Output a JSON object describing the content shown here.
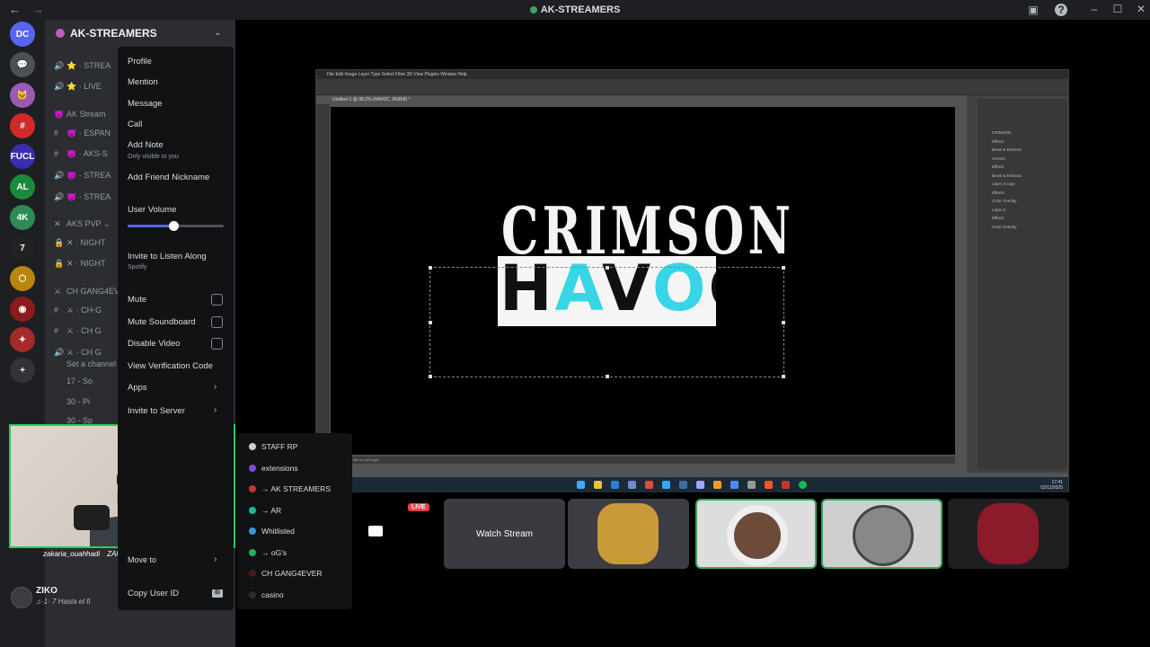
{
  "window": {
    "title": "AK-STREAMERS",
    "back": "←",
    "forward": "→"
  },
  "guilds": [
    {
      "label": "DC",
      "color": "#5865f2"
    },
    {
      "label": "💬",
      "color": "#4e5058"
    },
    {
      "label": "🐱",
      "color": "#9b59b6"
    },
    {
      "label": "#",
      "color": "#d12a2a"
    },
    {
      "label": "FUCL",
      "color": "#3b2db0"
    },
    {
      "label": "AL",
      "color": "#1a8a3a"
    },
    {
      "label": "4K",
      "color": "#2e8b57"
    },
    {
      "label": "7",
      "color": "#222"
    },
    {
      "label": "⬡",
      "color": "#b8860b"
    },
    {
      "label": "◉",
      "color": "#8b1a1a"
    },
    {
      "label": "✦",
      "color": "#a52a2a"
    },
    {
      "label": "+",
      "color": "#313338"
    }
  ],
  "sidebar": {
    "server_name": "AK-STREAMERS",
    "channels": [
      {
        "icon": "🔊",
        "text": "⭐ · STREA"
      },
      {
        "icon": "🔊",
        "text": "⭐ · LIVE"
      },
      {
        "icon": "😈",
        "text": "AK Stream"
      },
      {
        "icon": "#",
        "text": "😈 · ESPAN"
      },
      {
        "icon": "#",
        "text": "😈 · AKS-S"
      },
      {
        "icon": "🔊",
        "text": "😈 · STREA"
      },
      {
        "icon": "🔊",
        "text": "😈 · STREA"
      },
      {
        "icon": "✕",
        "text": "AKS PVP ⌄"
      },
      {
        "icon": "🔒",
        "text": "✕ · NIGHT"
      },
      {
        "icon": "🔒",
        "text": "✕ · NIGHT"
      },
      {
        "icon": "⚔",
        "text": "CH GANG4EV"
      },
      {
        "icon": "#",
        "text": "⚔ · CH-G"
      },
      {
        "icon": "#",
        "text": "⚔ · CH G"
      },
      {
        "icon": "🔊",
        "text": "⚔ · CH G"
      },
      {
        "icon": "",
        "text": "Set a channel"
      },
      {
        "icon": "",
        "text": "17 - So"
      },
      {
        "icon": "",
        "text": "30 - Pi"
      },
      {
        "icon": "",
        "text": "30 - Sp"
      }
    ]
  },
  "context_menu": {
    "profile": "Profile",
    "mention": "Mention",
    "message": "Message",
    "call": "Call",
    "add_note": "Add Note",
    "add_note_sub": "Only visible to you",
    "add_friend_nickname": "Add Friend Nickname",
    "user_volume": "User Volume",
    "user_volume_level": 0.48,
    "invite_listen": "Invite to Listen Along",
    "invite_listen_sub": "Spotify",
    "mute": "Mute",
    "mute_soundboard": "Mute Soundboard",
    "disable_video": "Disable Video",
    "view_verification": "View Verification Code",
    "apps": "Apps",
    "invite_to_server": "Invite to Server",
    "move_to": "Move to",
    "copy_user_id": "Copy User ID",
    "id_badge": "ID"
  },
  "submenu": {
    "items": [
      {
        "label": "STAFF RP",
        "color": "#d0d0d0"
      },
      {
        "label": "extensions",
        "color": "#7b4fd6"
      },
      {
        "label": "→ AK STREAMERS",
        "color": "#c0392b"
      },
      {
        "label": "→ AR",
        "color": "#1abc9c"
      },
      {
        "label": "Whitlisted",
        "color": "#3498db"
      },
      {
        "label": "→ oG's",
        "color": "#27ae60"
      },
      {
        "label": "CH GANG4EVER",
        "color": "#4a1a1a"
      },
      {
        "label": "casino",
        "color": "#2b2b2b"
      }
    ]
  },
  "webcam": {
    "socials": [
      "zakaria_ouahhadi",
      "ZAka4ia",
      "ZAka4ia"
    ]
  },
  "user": {
    "name": "ZIKO",
    "status": "♫·1· 7 Hasta el fi"
  },
  "photoshop": {
    "menus": "File  Edit  Image  Layer  Type  Select  Filter  3D  View  Plugins  Window  Help",
    "tab": "Untitled-1 @ 98.2% (HAVOC, RGB/8) *",
    "title_text": "CRIMSON",
    "havoc_letters": [
      {
        "ch": "H",
        "c": "b"
      },
      {
        "ch": "A",
        "c": "c"
      },
      {
        "ch": "V",
        "c": "b"
      },
      {
        "ch": "O",
        "c": "c"
      },
      {
        "ch": "C",
        "c": "b"
      }
    ],
    "layers": [
      "CRIMSON",
      "Effects",
      "Bevel & Emboss",
      "HAVOC",
      "Effects",
      "Bevel & Emboss",
      "Layer 3 copy",
      "Effects",
      "Color Overlay",
      "Layer 3",
      "Effects",
      "Color Overlay"
    ],
    "status": "2560 px x 1080 px (300 ppi)",
    "clock_time": "17:41",
    "clock_date": "02/11/2025"
  },
  "stream_tiles": {
    "live_badge": "LIVE",
    "watch_label": "Watch Stream"
  }
}
